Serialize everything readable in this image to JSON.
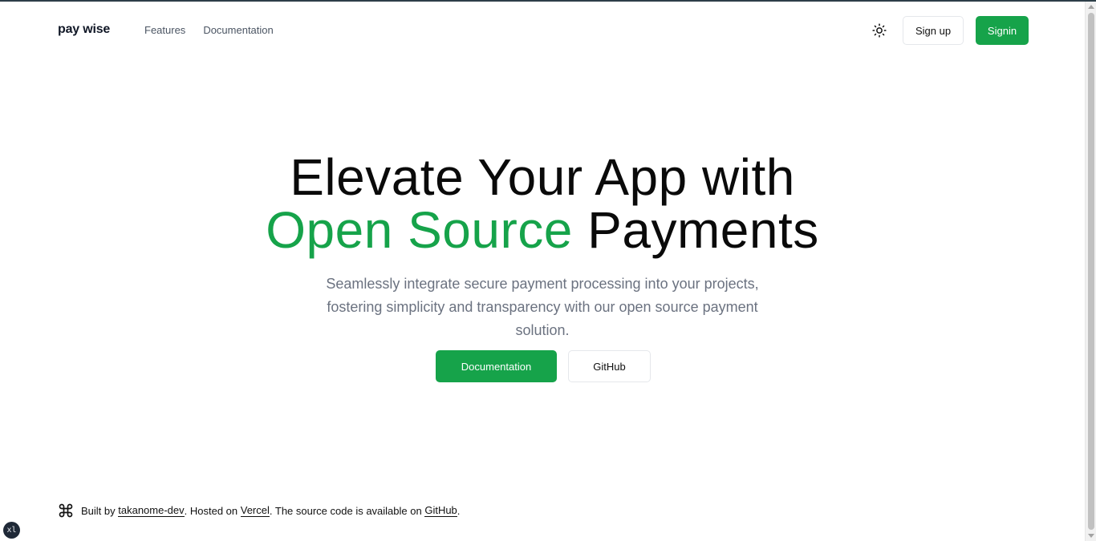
{
  "header": {
    "brand": "pay wise",
    "nav": [
      "Features",
      "Documentation"
    ],
    "theme_icon": "sun-icon",
    "signup_label": "Sign up",
    "signin_label": "Signin"
  },
  "hero": {
    "title_line1": "Elevate Your App with",
    "title_accent": "Open Source",
    "title_rest": " Payments",
    "description": "Seamlessly integrate secure payment processing into your projects, fostering simplicity and transparency with our open source payment solution.",
    "primary_cta": "Documentation",
    "secondary_cta": "GitHub"
  },
  "footer": {
    "icon": "command-icon",
    "prefix": "Built by ",
    "author_link": "takanome-dev",
    "hosted_text": ". Hosted on ",
    "host_link": "Vercel",
    "source_text": ". The source code is available on ",
    "source_link": "GitHub",
    "suffix": "."
  },
  "devtools_badge": "xl",
  "colors": {
    "accent": "#16a34a",
    "text": "#0a0a0a",
    "muted": "#6b7280"
  }
}
